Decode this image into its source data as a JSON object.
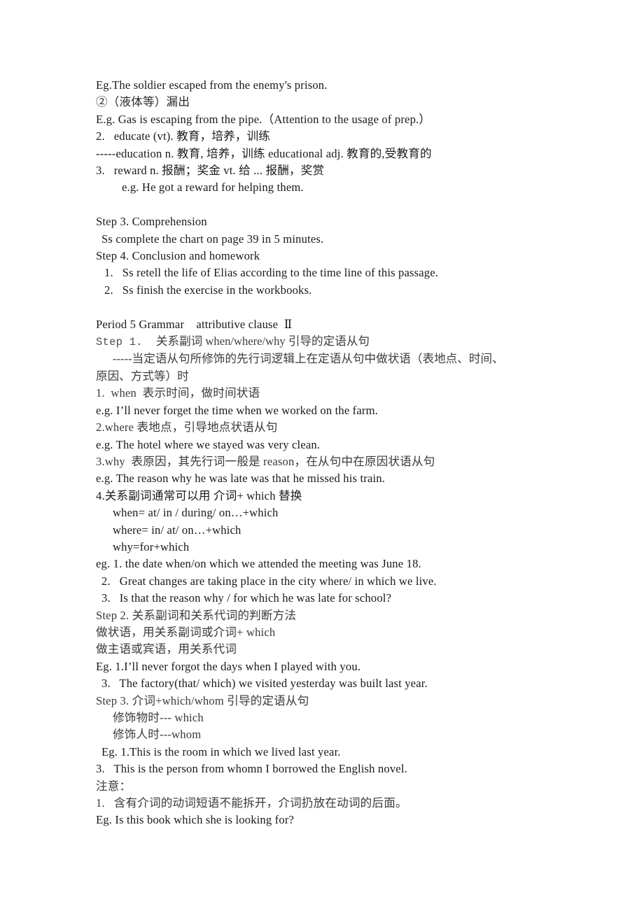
{
  "document": {
    "title": "English Lesson Plan — Period 4 Vocabulary / Period 5 Grammar",
    "page_background": "#ffffff",
    "text_color": "#1a1a1a",
    "accent_gray": "#4d4d4d"
  },
  "lines": [
    {
      "id": "l01",
      "text": "Eg.The soldier escaped from the enemy's prison."
    },
    {
      "id": "l02",
      "text": "②（液体等）漏出"
    },
    {
      "id": "l03",
      "text": "E.g. Gas is escaping from the pipe.（Attention to the usage of prep.）"
    },
    {
      "id": "l04",
      "text": "2.   educate (vt). 教育，培养，训练"
    },
    {
      "id": "l05",
      "text": "-----education n. 教育, 培养，训练 educational adj. 教育的,受教育的"
    },
    {
      "id": "l06",
      "text": "3.   reward n. 报酬；奖金 vt. 给 ... 报酬，奖赏"
    },
    {
      "id": "l07",
      "text": "e.g. He got a reward for helping them."
    },
    {
      "id": "l08",
      "text": ""
    },
    {
      "id": "l09",
      "text": "Step 3. Comprehension"
    },
    {
      "id": "l10",
      "text": "Ss complete the chart on page 39 in 5 minutes."
    },
    {
      "id": "l11",
      "text": "Step 4. Conclusion and homework"
    },
    {
      "id": "l12",
      "text": "1.   Ss retell the life of Elias according to the time line of this passage."
    },
    {
      "id": "l13",
      "text": "2.   Ss finish the exercise in the workbooks."
    },
    {
      "id": "l14",
      "text": ""
    },
    {
      "id": "l15",
      "text": "Period 5 Grammar    attributive clause  Ⅱ"
    },
    {
      "id": "l16a",
      "text": "Step 1.  "
    },
    {
      "id": "l16b",
      "text": "关系副词 when/where/why 引导的定语从句"
    },
    {
      "id": "l17",
      "text": "-----当定语从句所修饰的先行词逻辑上在定语从句中做状语（表地点、时间、"
    },
    {
      "id": "l18",
      "text": "原因、方式等）时"
    },
    {
      "id": "l19",
      "text": "1.  when  表示时间，做时间状语"
    },
    {
      "id": "l20",
      "text": "e.g. I’ll never forget the time when we worked on the farm."
    },
    {
      "id": "l21",
      "text": "2.where 表地点，引导地点状语从句"
    },
    {
      "id": "l22",
      "text": "e.g. The hotel where we stayed was very clean."
    },
    {
      "id": "l23",
      "text": "3.why  表原因，其先行词一般是 reason，在从句中在原因状语从句"
    },
    {
      "id": "l24",
      "text": "e.g. The reason why he was late was that he missed his train."
    },
    {
      "id": "l25",
      "text": "4.关系副词通常可以用 介词+ which 替换"
    },
    {
      "id": "l26",
      "text": "when= at/ in / during/ on…+which"
    },
    {
      "id": "l27",
      "text": "where= in/ at/ on…+which"
    },
    {
      "id": "l28",
      "text": "why=for+which"
    },
    {
      "id": "l29",
      "text": "eg. 1. the date when/on which we attended the meeting was June 18."
    },
    {
      "id": "l30",
      "text": "2.   Great changes are taking place in the city where/ in which we live."
    },
    {
      "id": "l31",
      "text": "3.   Is that the reason why / for which he was late for school?"
    },
    {
      "id": "l32",
      "text": "Step 2. 关系副词和关系代词的判断方法"
    },
    {
      "id": "l33",
      "text": "做状语，用关系副词或介词+ which"
    },
    {
      "id": "l34",
      "text": "做主语或宾语，用关系代词"
    },
    {
      "id": "l35",
      "text": "Eg. 1.I’ll never forgot the days when I played with you."
    },
    {
      "id": "l36",
      "text": "3.   The factory(that/ which) we visited yesterday was built last year."
    },
    {
      "id": "l37",
      "text": "Step 3. 介词+which/whom 引导的定语从句"
    },
    {
      "id": "l38",
      "text": "修饰物时--- which"
    },
    {
      "id": "l39",
      "text": "修饰人时---whom"
    },
    {
      "id": "l40",
      "text": "Eg. 1.This is the room in which we lived last year."
    },
    {
      "id": "l41",
      "text": "3.   This is the person from whomn I borrowed the English novel."
    },
    {
      "id": "l42",
      "text": "注意："
    },
    {
      "id": "l43",
      "text": "1.   含有介词的动词短语不能拆开，介词扔放在动词的后面。"
    },
    {
      "id": "l44",
      "text": "Eg. Is this book which she is looking for?"
    }
  ]
}
